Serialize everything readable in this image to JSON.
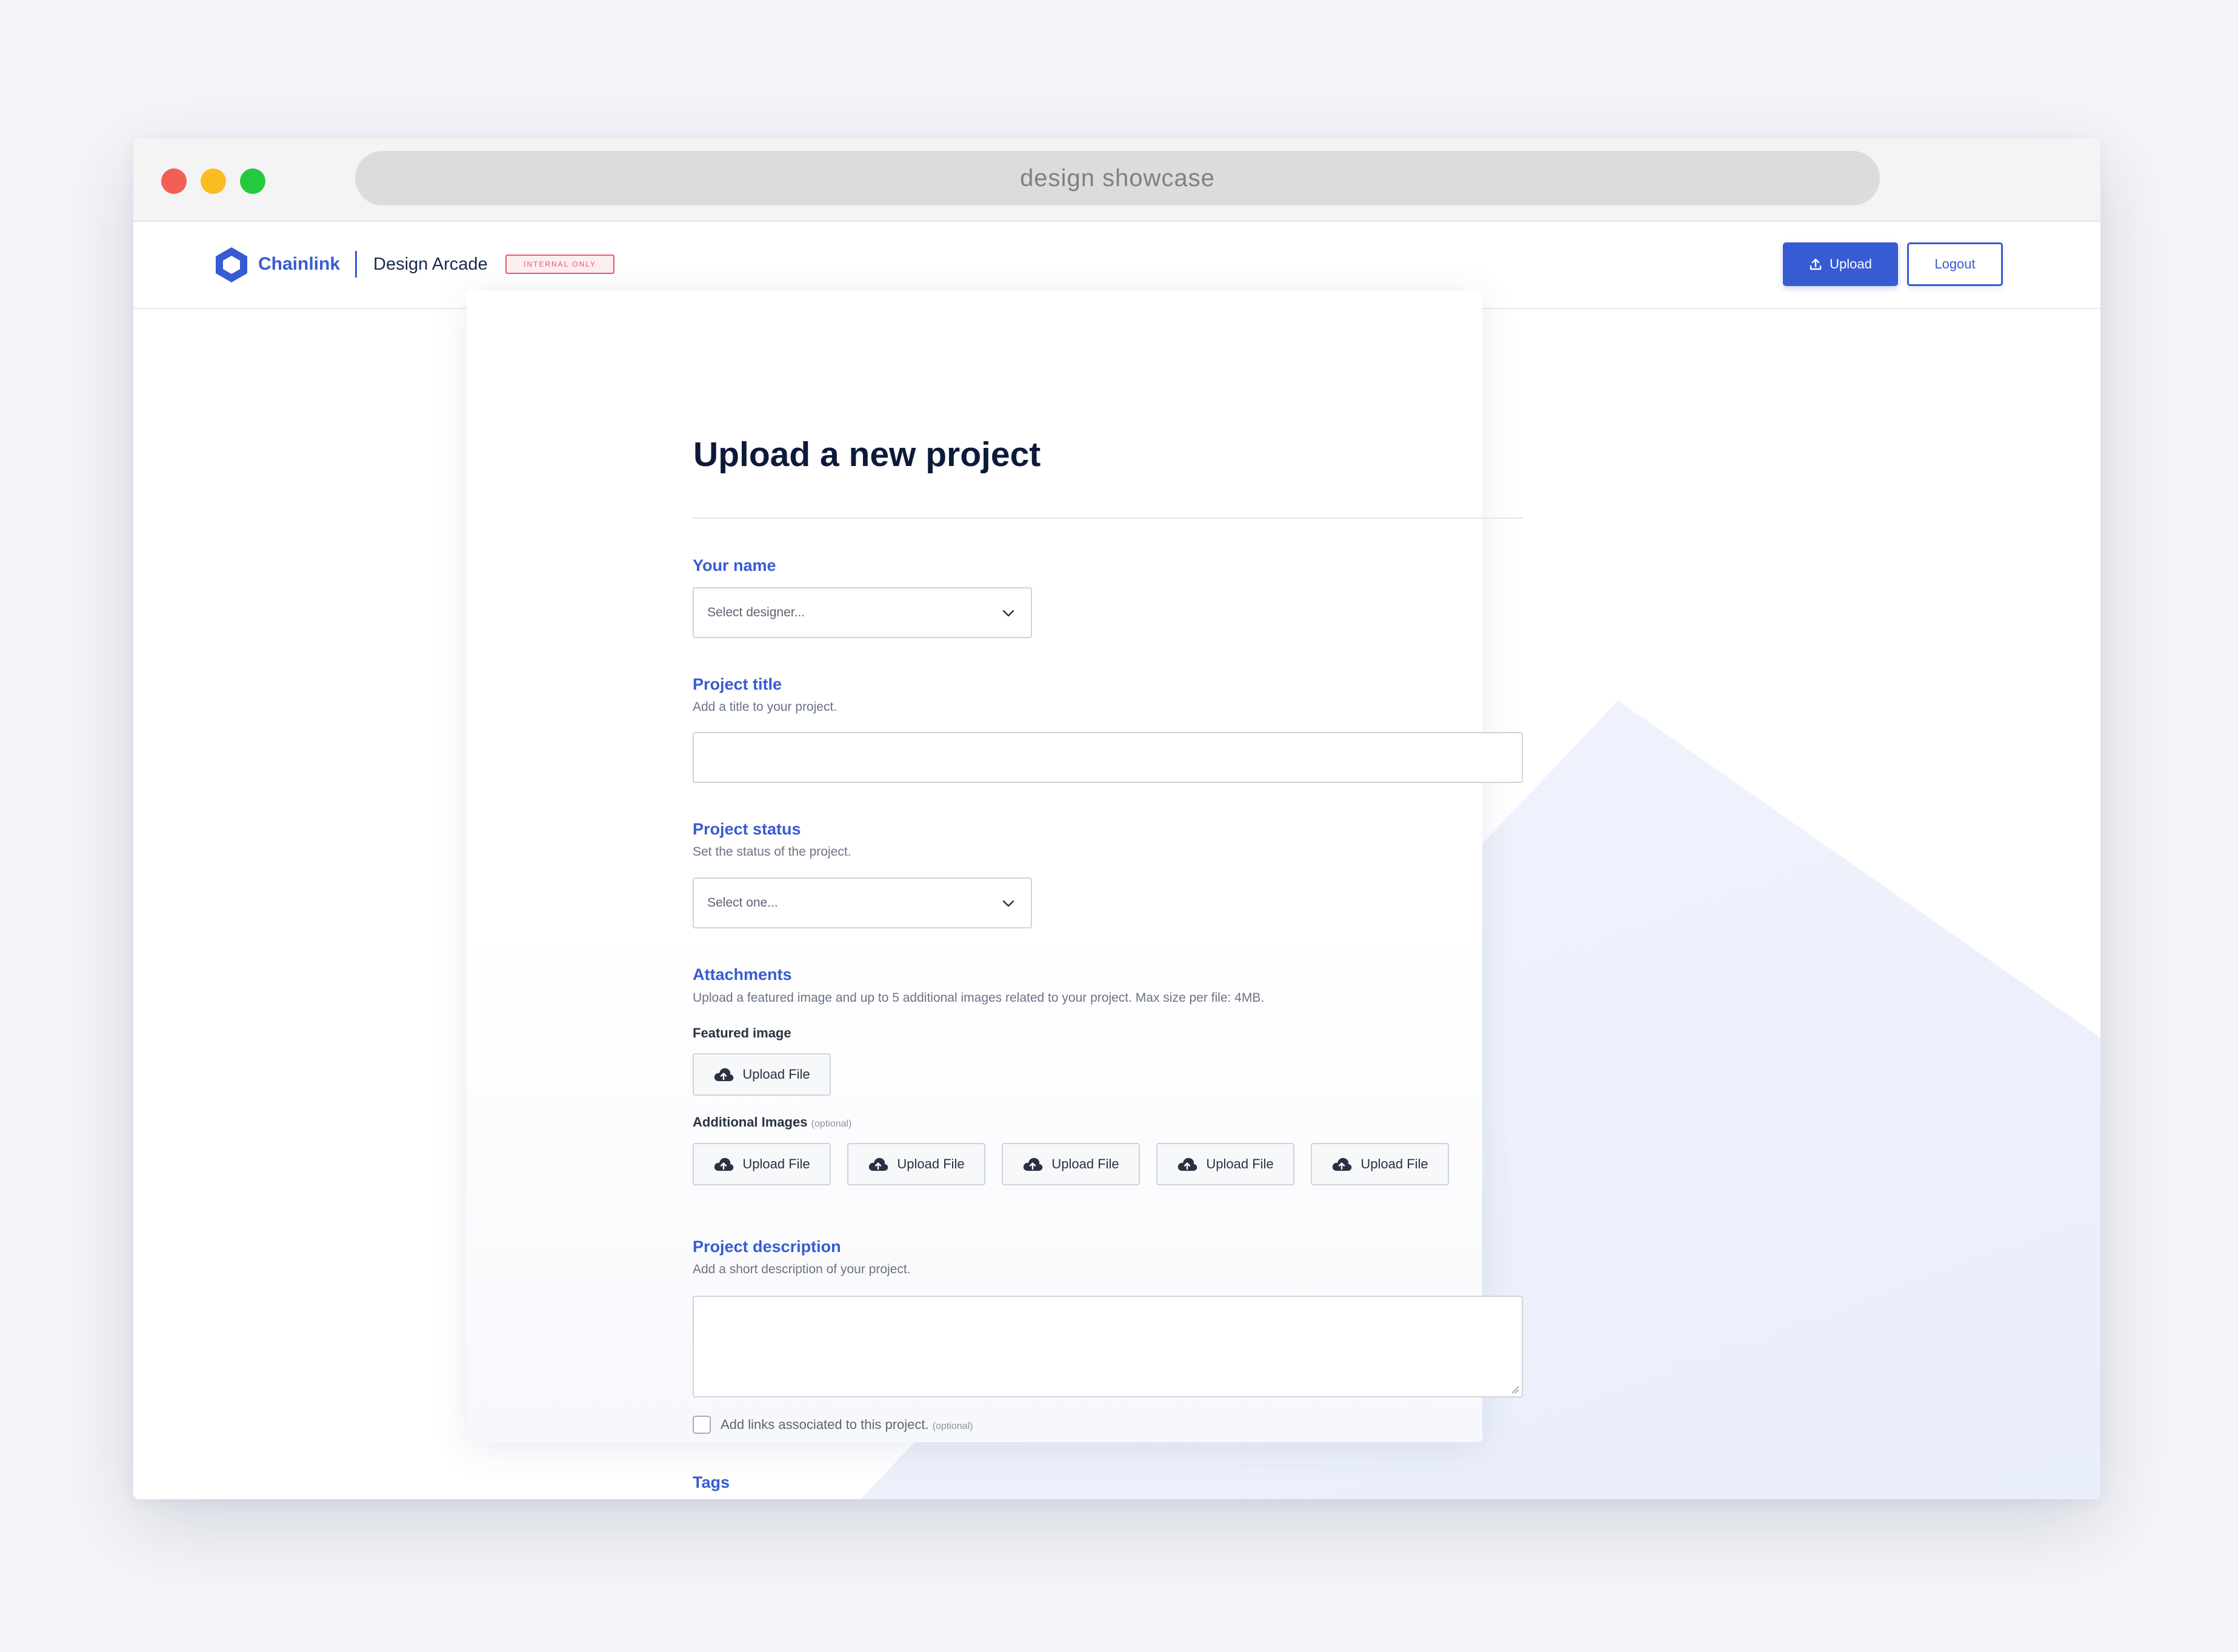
{
  "browser": {
    "url_text": "design showcase"
  },
  "navbar": {
    "brand": "Chainlink",
    "app_name": "Design Arcade",
    "badge": "INTERNAL ONLY",
    "upload_label": "Upload",
    "logout_label": "Logout"
  },
  "form": {
    "title": "Upload a new project",
    "your_name": {
      "label": "Your name",
      "value": "Select designer..."
    },
    "project_title": {
      "label": "Project title",
      "hint": "Add a title to your project.",
      "value": ""
    },
    "project_status": {
      "label": "Project status",
      "hint": "Set the status of the project.",
      "value": "Select one..."
    },
    "attachments": {
      "label": "Attachments",
      "hint": "Upload a featured image and up to 5 additional images related to your project. Max size per file: 4MB.",
      "featured_label": "Featured image",
      "featured_button": "Upload File",
      "additional_label": "Additional Images",
      "additional_optional": "(optional)",
      "additional_buttons": [
        "Upload File",
        "Upload File",
        "Upload File",
        "Upload File",
        "Upload File"
      ]
    },
    "project_description": {
      "label": "Project description",
      "hint": "Add a short description of your project.",
      "value": ""
    },
    "links_checkbox": {
      "label": "Add links associated to this project.",
      "optional": "(optional)",
      "checked": false
    },
    "tags": {
      "label": "Tags"
    }
  },
  "colors": {
    "accent": "#375bd2",
    "badge": "#e05b6a",
    "title_text": "#0c1a3a"
  },
  "icons": {
    "logo": "chainlink-hexagon-icon",
    "upload": "upload-icon",
    "select_arrow": "chevron-down-icon",
    "file_upload": "cloud-upload-icon"
  }
}
